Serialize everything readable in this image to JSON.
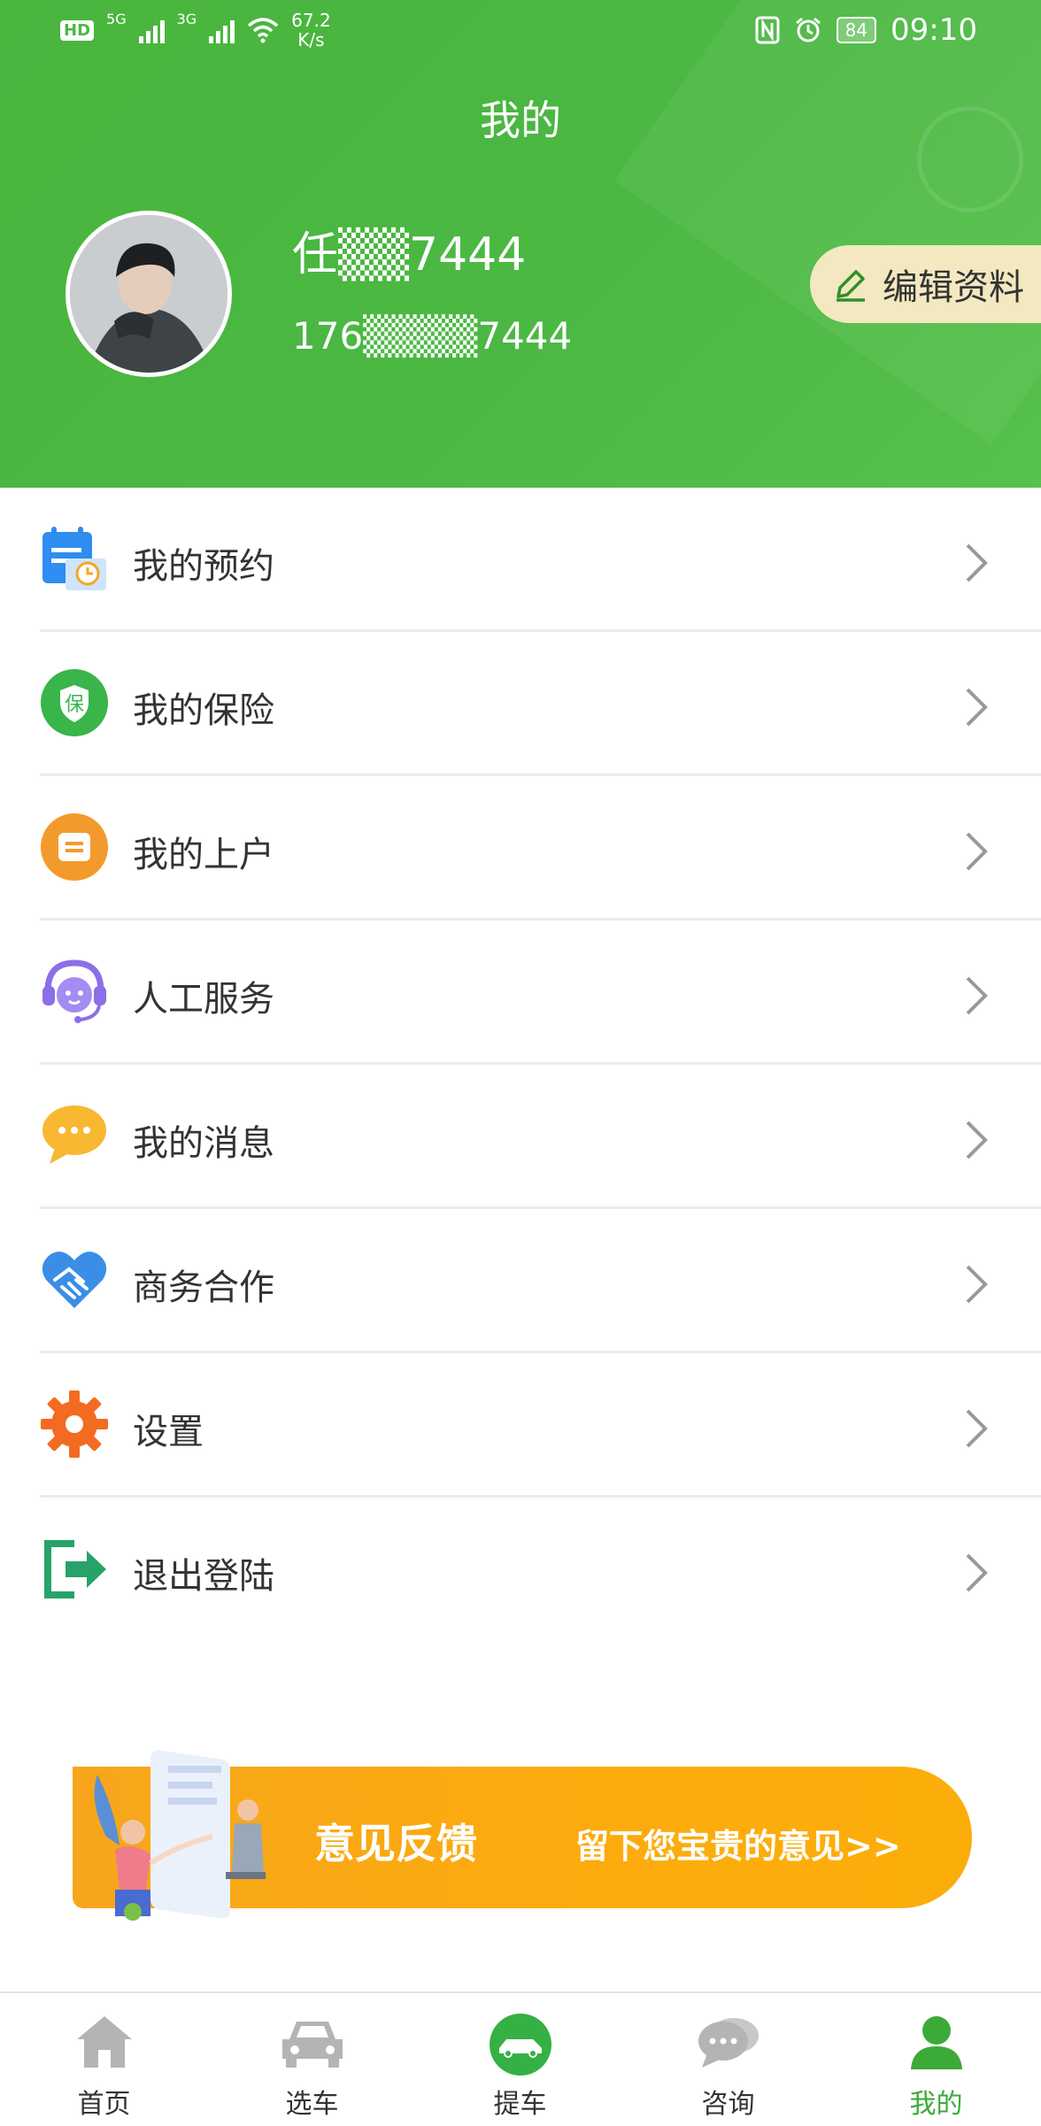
{
  "status_bar": {
    "network_left": "HD",
    "net1": "5G",
    "net2": "3G",
    "speed_value": "67.2",
    "speed_unit": "K/s",
    "battery": "84",
    "time": "09:10"
  },
  "header": {
    "title": "我的",
    "username": "任▒▒7444",
    "phone": "176▒▒▒▒7444",
    "edit_button": "编辑资料"
  },
  "menu": {
    "items": [
      {
        "label": "我的预约",
        "icon": "calendar-clock-icon"
      },
      {
        "label": "我的保险",
        "icon": "insurance-shield-icon"
      },
      {
        "label": "我的上户",
        "icon": "registration-doc-icon"
      },
      {
        "label": "人工服务",
        "icon": "customer-service-headset-icon"
      },
      {
        "label": "我的消息",
        "icon": "chat-bubble-icon"
      },
      {
        "label": "商务合作",
        "icon": "handshake-icon"
      },
      {
        "label": "设置",
        "icon": "gear-icon"
      },
      {
        "label": "退出登陆",
        "icon": "logout-icon"
      }
    ]
  },
  "feedback_banner": {
    "title": "意见反馈",
    "subtitle": "留下您宝贵的意见>>"
  },
  "tabbar": {
    "tabs": [
      {
        "label": "首页",
        "icon": "home-icon"
      },
      {
        "label": "选车",
        "icon": "car-icon"
      },
      {
        "label": "提车",
        "icon": "pickup-car-icon"
      },
      {
        "label": "咨询",
        "icon": "chat-icon"
      },
      {
        "label": "我的",
        "icon": "user-icon"
      }
    ],
    "active_index": 4
  },
  "colors": {
    "brand_green": "#4bb843",
    "active_tab": "#3caa38",
    "banner_orange": "#fdab0c",
    "edit_button_bg": "#f3e8c0"
  }
}
